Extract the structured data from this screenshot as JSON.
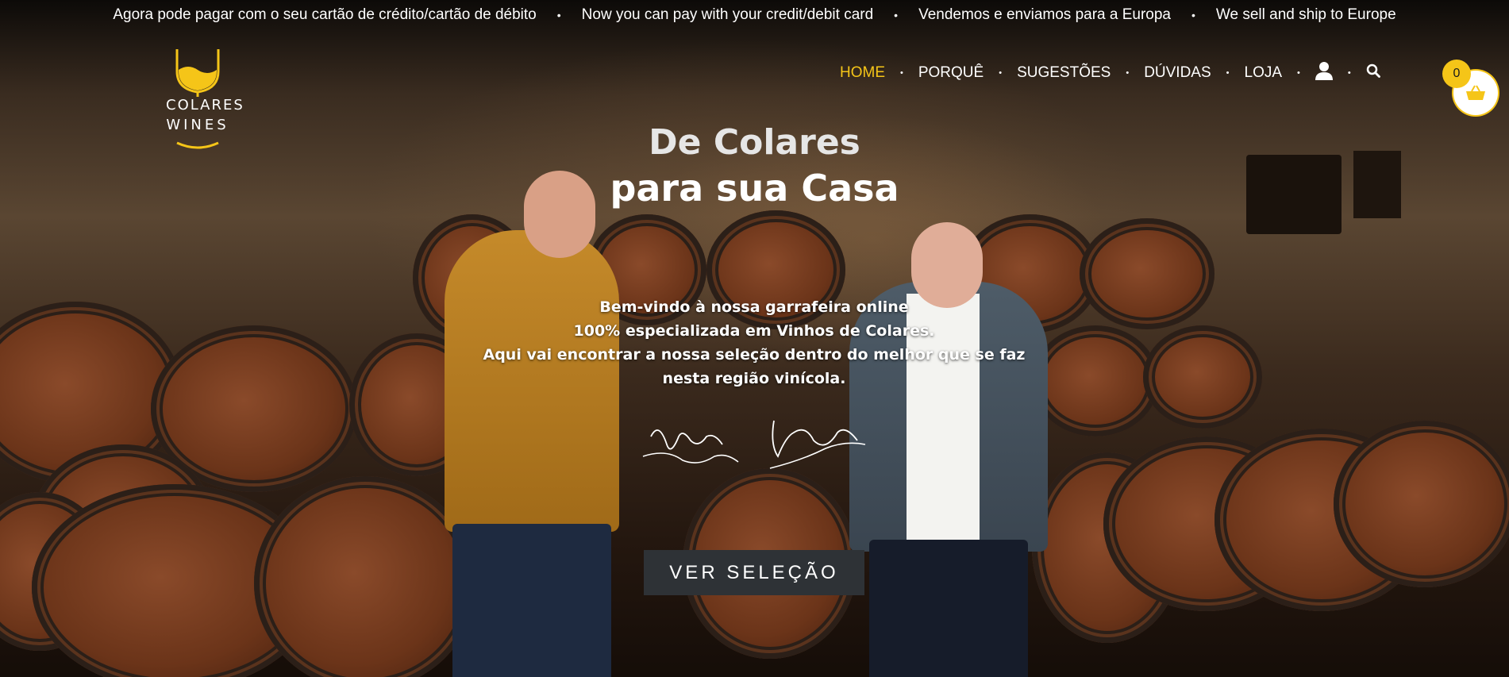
{
  "topbar": {
    "items": [
      "Agora pode pagar com o seu cartão de crédito/cartão de débito",
      "Now you can pay with your credit/debit card",
      "Vendemos e enviamos para a Europa",
      "We sell and ship to Europe"
    ],
    "separator": "•"
  },
  "logo": {
    "line1": "COLARES",
    "line2": "WINES",
    "accent": "#f5c518"
  },
  "nav": {
    "items": [
      "HOME",
      "PORQUÊ",
      "SUGESTÕES",
      "DÚVIDAS",
      "LOJA"
    ],
    "active": "HOME",
    "separator": "•",
    "icons": [
      "user-icon",
      "search-icon"
    ]
  },
  "cart": {
    "count": "0",
    "icon": "basket-icon"
  },
  "hero": {
    "title_line1": "De Colares",
    "title_line2": "para sua Casa",
    "welcome_lines": [
      "Bem-vindo à nossa garrafeira online",
      "100% especializada em Vinhos de Colares.",
      "Aqui vai encontrar a nossa seleção dentro do melhor que se faz",
      "nesta região vinícola."
    ],
    "cta_label": "VER SELEÇÃO"
  },
  "colors": {
    "accent": "#f5c518",
    "button": "#2e3236"
  }
}
